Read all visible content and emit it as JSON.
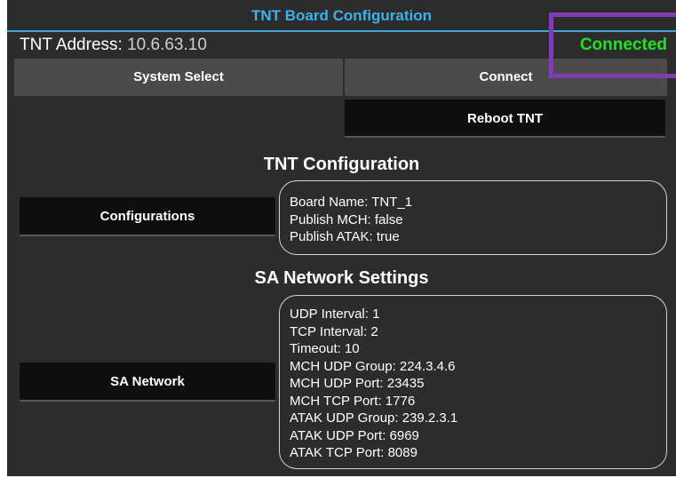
{
  "window": {
    "title": "TNT Board Configuration"
  },
  "header": {
    "address_label": "TNT Address:",
    "address_value": "10.6.63.10",
    "status": "Connected",
    "status_color": "#22e022"
  },
  "buttons": {
    "system_select": "System Select",
    "connect": "Connect",
    "reboot": "Reboot TNT",
    "configurations": "Configurations",
    "sa_network": "SA Network"
  },
  "tnt_config": {
    "title": "TNT Configuration",
    "lines": [
      "Board Name: TNT_1",
      "Publish MCH: false",
      "Publish ATAK: true"
    ]
  },
  "sa_network": {
    "title": "SA Network Settings",
    "lines": [
      "UDP Interval: 1",
      "TCP Interval: 2",
      "Timeout: 10",
      "MCH UDP Group: 224.3.4.6",
      "MCH UDP Port: 23435",
      "MCH TCP Port: 1776",
      "ATAK UDP Group: 239.2.3.1",
      "ATAK UDP Port: 6969",
      "ATAK TCP Port: 8089"
    ]
  },
  "colors": {
    "accent": "#3fb0e8",
    "background": "#2c2c2c",
    "highlight": "#7b3fae"
  }
}
